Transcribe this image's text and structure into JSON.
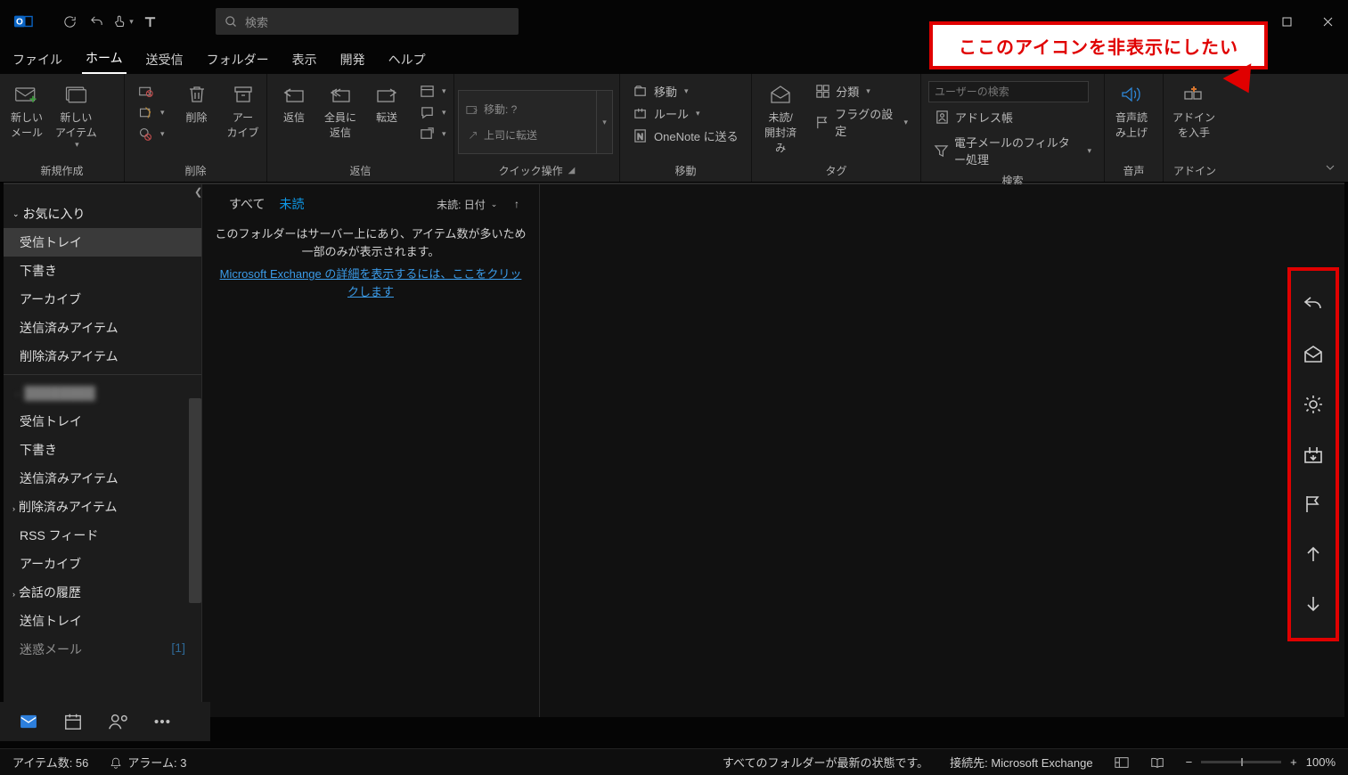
{
  "search": {
    "placeholder": "検索"
  },
  "tabs": [
    "ファイル",
    "ホーム",
    "送受信",
    "フォルダー",
    "表示",
    "開発",
    "ヘルプ"
  ],
  "ribbon": {
    "new_mail": "新しい\nメール",
    "new_item": "新しい\nアイテム",
    "group_new": "新規作成",
    "delete_btn": "削除",
    "archive": "アー\nカイブ",
    "group_delete": "削除",
    "reply": "返信",
    "reply_all": "全員に\n返信",
    "forward": "転送",
    "group_reply": "返信",
    "quick_move": "移動: ?",
    "quick_boss": "上司に転送",
    "group_quick": "クイック操作",
    "move": "移動",
    "rules": "ルール",
    "onenote": "OneNote に送る",
    "group_move": "移動",
    "unread": "未読/\n開封済み",
    "category": "分類",
    "flag": "フラグの設定",
    "group_tag": "タグ",
    "search_user_ph": "ユーザーの検索",
    "addr": "アドレス帳",
    "filter": "電子メールのフィルター処理",
    "group_search": "検索",
    "tts": "音声読\nみ上げ",
    "group_tts": "音声",
    "addin": "アドイン\nを入手",
    "group_addin": "アドイン"
  },
  "nav": {
    "fav": "お気に入り",
    "fav_items": [
      "受信トレイ",
      "下書き",
      "アーカイブ",
      "送信済みアイテム",
      "削除済みアイテム"
    ],
    "account": "████████",
    "acct_items": [
      {
        "l": "受信トレイ"
      },
      {
        "l": "下書き"
      },
      {
        "l": "送信済みアイテム"
      },
      {
        "l": "削除済みアイテム",
        "ex": true
      },
      {
        "l": "RSS フィード"
      },
      {
        "l": "アーカイブ"
      },
      {
        "l": "会話の履歴",
        "ex": true
      },
      {
        "l": "送信トレイ"
      },
      {
        "l": "迷惑メール",
        "c": "[1]",
        "cut": true
      }
    ]
  },
  "list": {
    "tab_all": "すべて",
    "tab_unread": "未読",
    "filter": "未読:  日付",
    "info": "このフォルダーはサーバー上にあり、アイテム数が多いため一部のみが表示されます。",
    "link": "Microsoft Exchange の詳細を表示するには、ここをクリックします"
  },
  "callout": "ここのアイコンを非表示にしたい",
  "status": {
    "items": "アイテム数: 56",
    "alarm": "アラーム: 3",
    "sync": "すべてのフォルダーが最新の状態です。",
    "conn": "接続先: Microsoft Exchange",
    "zoom": "100%"
  }
}
